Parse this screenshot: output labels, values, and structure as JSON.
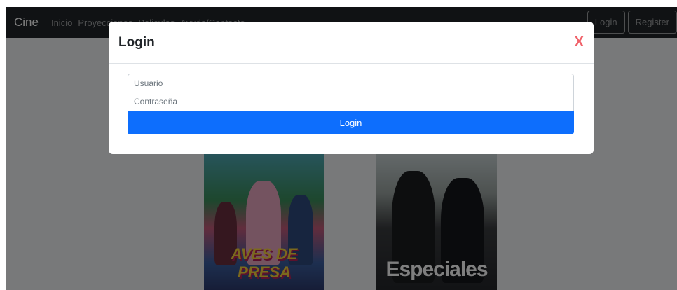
{
  "navbar": {
    "brand": "Cine",
    "links": [
      "Inicio",
      "Proyecciones",
      "Peliculas",
      "Ayuda/Contacto"
    ],
    "login_label": "Login",
    "register_label": "Register"
  },
  "posters": [
    {
      "title": "AVES DE PRESA"
    },
    {
      "title": "Especiales"
    }
  ],
  "modal": {
    "title": "Login",
    "close_label": "X",
    "username_placeholder": "Usuario",
    "password_placeholder": "Contraseña",
    "submit_label": "Login"
  },
  "colors": {
    "navbar_bg": "#212529",
    "primary": "#0d6efd",
    "close": "#f0626a"
  }
}
